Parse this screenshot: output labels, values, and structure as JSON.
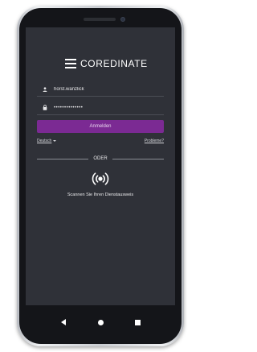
{
  "app": {
    "logo_text": "COREDINATE"
  },
  "login": {
    "username_value": "horst.wanzlick",
    "password_value": "••••••••••••••",
    "login_button_label": "Anmelden",
    "language_label": "Deutsch",
    "problems_link": "Probleme?",
    "divider_label": "ODER",
    "scan_instruction": "Scannen Sie Ihren Dienstausweis"
  },
  "icons": {
    "user_field": "user-icon",
    "password_field": "lock-icon",
    "nfc": "nfc-icon",
    "nav_back": "back-triangle-icon",
    "nav_home": "home-circle-icon",
    "nav_recent": "recent-square-icon"
  },
  "colors": {
    "screen_background": "#2f3138",
    "accent": "#7b2a93",
    "text": "#e8e8ea"
  }
}
